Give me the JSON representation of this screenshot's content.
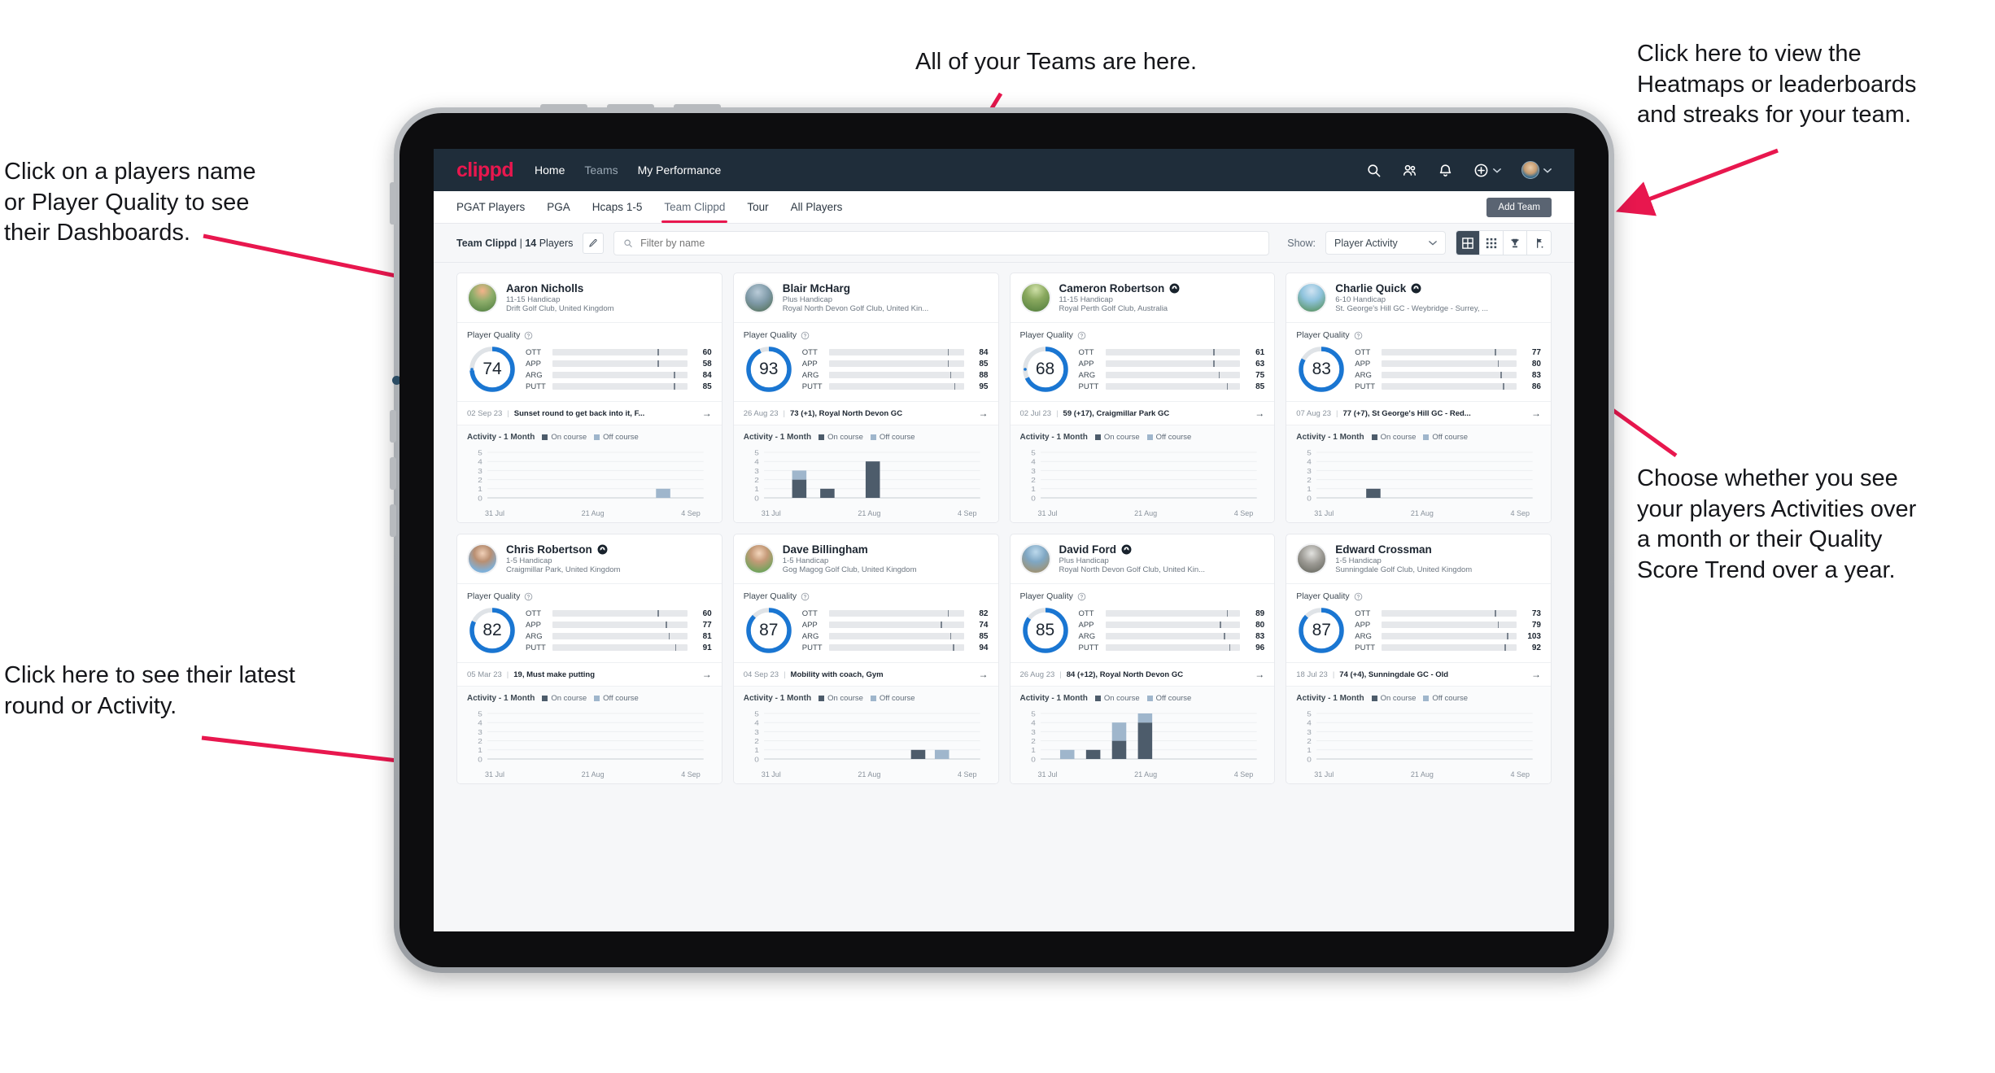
{
  "annotations": [
    {
      "id": "teams",
      "text": "All of your Teams are here."
    },
    {
      "id": "heatmaps",
      "text": "Click here to view the\nHeatmaps or leaderboards\nand streaks for your team."
    },
    {
      "id": "players-name",
      "text": "Click on a players name\nor Player Quality to see\ntheir Dashboards."
    },
    {
      "id": "activity-choice",
      "text": "Choose whether you see\nyour players Activities over\na month or their Quality\nScore Trend over a year."
    },
    {
      "id": "latest-round",
      "text": "Click here to see their latest\nround or Activity."
    }
  ],
  "nav": {
    "logo": "clippd",
    "links": [
      {
        "label": "Home",
        "active": true
      },
      {
        "label": "Teams",
        "active": false
      },
      {
        "label": "My Performance",
        "active": true
      }
    ],
    "icons": [
      "search-icon",
      "people-icon",
      "bell-icon",
      "plus-circle-icon",
      "avatar-icon"
    ]
  },
  "tabs": [
    {
      "label": "PGAT Players",
      "active": false
    },
    {
      "label": "PGA",
      "active": false
    },
    {
      "label": "Hcaps 1-5",
      "active": false
    },
    {
      "label": "Team Clippd",
      "active": true
    },
    {
      "label": "Tour",
      "active": false
    },
    {
      "label": "All Players",
      "active": false
    }
  ],
  "add_team_label": "Add Team",
  "toolbar": {
    "team_name": "Team Clippd",
    "separator": "|",
    "player_count": "14",
    "players_word": "Players",
    "edit_icon": "pencil-icon",
    "search_placeholder": "Filter by name",
    "search_value": "",
    "show_label": "Show:",
    "show_selected": "Player Activity",
    "view_buttons": [
      {
        "name": "grid-large-view",
        "active": true
      },
      {
        "name": "grid-dense-view",
        "active": false
      },
      {
        "name": "trophy-leaderboard-view",
        "active": false
      },
      {
        "name": "golf-flag-view",
        "active": false
      }
    ]
  },
  "card_labels": {
    "player_quality": "Player Quality",
    "activity_title": "Activity - 1 Month",
    "legend_on": "On course",
    "legend_off": "Off course"
  },
  "colors": {
    "brand_pink": "#e8174e",
    "nav_bg": "#1f2d3a",
    "ring_blue": "#1a76d2",
    "ott": "#f5a623",
    "app": "#3ed6ad",
    "arg": "#f31a5e",
    "putt": "#ae24c9",
    "on_course": "#4d5c6b",
    "off_course": "#9fb6cc"
  },
  "chart_data": {
    "type": "bar",
    "title": "Activity - 1 Month",
    "ylim": [
      0,
      5
    ],
    "yticks": [
      5,
      4,
      3,
      2,
      1,
      0
    ],
    "xlabels": [
      "31 Jul",
      "21 Aug",
      "4 Sep"
    ],
    "series_names": [
      "On course",
      "Off course"
    ],
    "per_player": {
      "Aaron Nicholls": [
        {
          "x": 0.78,
          "on": 0,
          "off": 1
        }
      ],
      "Blair McHarg": [
        {
          "x": 0.13,
          "on": 2,
          "off": 1
        },
        {
          "x": 0.26,
          "on": 1,
          "off": 0
        },
        {
          "x": 0.47,
          "on": 4,
          "off": 0
        }
      ],
      "Cameron Robertson": [],
      "Charlie Quick": [
        {
          "x": 0.23,
          "on": 1,
          "off": 0
        }
      ],
      "Chris Robertson": [],
      "Dave Billingham": [
        {
          "x": 0.68,
          "on": 1,
          "off": 0
        },
        {
          "x": 0.79,
          "on": 0,
          "off": 1
        }
      ],
      "David Ford": [
        {
          "x": 0.09,
          "on": 0,
          "off": 1
        },
        {
          "x": 0.21,
          "on": 1,
          "off": 0
        },
        {
          "x": 0.33,
          "on": 2,
          "off": 2
        },
        {
          "x": 0.45,
          "on": 4,
          "off": 1
        }
      ],
      "Edward Crossman": []
    }
  },
  "players": [
    {
      "name": "Aaron Nicholls",
      "verified": false,
      "handicap": "11-15 Handicap",
      "club": "Drift Golf Club, United Kingdom",
      "score": 74,
      "metrics": [
        {
          "label": "OTT",
          "value": 60,
          "pct": 60,
          "tick": 78
        },
        {
          "label": "APP",
          "value": 58,
          "pct": 58,
          "tick": 78
        },
        {
          "label": "ARG",
          "value": 84,
          "pct": 82,
          "tick": 90
        },
        {
          "label": "PUTT",
          "value": 85,
          "pct": 84,
          "tick": 90
        }
      ],
      "round_date": "02 Sep 23",
      "round_text": "Sunset round to get back into it, F..."
    },
    {
      "name": "Blair McHarg",
      "verified": false,
      "handicap": "Plus Handicap",
      "club": "Royal North Devon Golf Club, United Kin...",
      "score": 93,
      "metrics": [
        {
          "label": "OTT",
          "value": 84,
          "pct": 80,
          "tick": 88
        },
        {
          "label": "APP",
          "value": 85,
          "pct": 80,
          "tick": 88
        },
        {
          "label": "ARG",
          "value": 88,
          "pct": 82,
          "tick": 90
        },
        {
          "label": "PUTT",
          "value": 95,
          "pct": 88,
          "tick": 93
        }
      ],
      "round_date": "26 Aug 23",
      "round_text": "73 (+1), Royal North Devon GC"
    },
    {
      "name": "Cameron Robertson",
      "verified": true,
      "handicap": "11-15 Handicap",
      "club": "Royal Perth Golf Club, Australia",
      "score": 68,
      "metrics": [
        {
          "label": "OTT",
          "value": 61,
          "pct": 58,
          "tick": 80
        },
        {
          "label": "APP",
          "value": 63,
          "pct": 60,
          "tick": 80
        },
        {
          "label": "ARG",
          "value": 75,
          "pct": 72,
          "tick": 84
        },
        {
          "label": "PUTT",
          "value": 85,
          "pct": 82,
          "tick": 90
        }
      ],
      "round_date": "02 Jul 23",
      "round_text": "59 (+17), Craigmillar Park GC"
    },
    {
      "name": "Charlie Quick",
      "verified": true,
      "handicap": "6-10 Handicap",
      "club": "St. George's Hill GC - Weybridge - Surrey, ...",
      "score": 83,
      "metrics": [
        {
          "label": "OTT",
          "value": 77,
          "pct": 72,
          "tick": 84
        },
        {
          "label": "APP",
          "value": 80,
          "pct": 76,
          "tick": 86
        },
        {
          "label": "ARG",
          "value": 83,
          "pct": 80,
          "tick": 88
        },
        {
          "label": "PUTT",
          "value": 86,
          "pct": 84,
          "tick": 90
        }
      ],
      "round_date": "07 Aug 23",
      "round_text": "77 (+7), St George's Hill GC - Red..."
    },
    {
      "name": "Chris Robertson",
      "verified": true,
      "handicap": "1-5 Handicap",
      "club": "Craigmillar Park, United Kingdom",
      "score": 82,
      "metrics": [
        {
          "label": "OTT",
          "value": 60,
          "pct": 56,
          "tick": 78
        },
        {
          "label": "APP",
          "value": 77,
          "pct": 72,
          "tick": 84
        },
        {
          "label": "ARG",
          "value": 81,
          "pct": 76,
          "tick": 86
        },
        {
          "label": "PUTT",
          "value": 91,
          "pct": 86,
          "tick": 91
        }
      ],
      "round_date": "05 Mar 23",
      "round_text": "19, Must make putting"
    },
    {
      "name": "Dave Billingham",
      "verified": false,
      "handicap": "1-5 Handicap",
      "club": "Gog Magog Golf Club, United Kingdom",
      "score": 87,
      "metrics": [
        {
          "label": "OTT",
          "value": 82,
          "pct": 80,
          "tick": 88
        },
        {
          "label": "APP",
          "value": 74,
          "pct": 70,
          "tick": 83
        },
        {
          "label": "ARG",
          "value": 85,
          "pct": 84,
          "tick": 90
        },
        {
          "label": "PUTT",
          "value": 94,
          "pct": 88,
          "tick": 92
        }
      ],
      "round_date": "04 Sep 23",
      "round_text": "Mobility with coach, Gym"
    },
    {
      "name": "David Ford",
      "verified": true,
      "handicap": "Plus Handicap",
      "club": "Royal North Devon Golf Club, United Kin...",
      "score": 85,
      "metrics": [
        {
          "label": "OTT",
          "value": 89,
          "pct": 84,
          "tick": 90
        },
        {
          "label": "APP",
          "value": 80,
          "pct": 74,
          "tick": 85
        },
        {
          "label": "ARG",
          "value": 83,
          "pct": 80,
          "tick": 88
        },
        {
          "label": "PUTT",
          "value": 96,
          "pct": 88,
          "tick": 92
        }
      ],
      "round_date": "26 Aug 23",
      "round_text": "84 (+12), Royal North Devon GC"
    },
    {
      "name": "Edward Crossman",
      "verified": false,
      "handicap": "1-5 Handicap",
      "club": "Sunningdale Golf Club, United Kingdom",
      "score": 87,
      "metrics": [
        {
          "label": "OTT",
          "value": 73,
          "pct": 70,
          "tick": 84
        },
        {
          "label": "APP",
          "value": 79,
          "pct": 76,
          "tick": 86
        },
        {
          "label": "ARG",
          "value": 103,
          "pct": 88,
          "tick": 93
        },
        {
          "label": "PUTT",
          "value": 92,
          "pct": 86,
          "tick": 91
        }
      ],
      "round_date": "18 Jul 23",
      "round_text": "74 (+4), Sunningdale GC - Old"
    }
  ]
}
